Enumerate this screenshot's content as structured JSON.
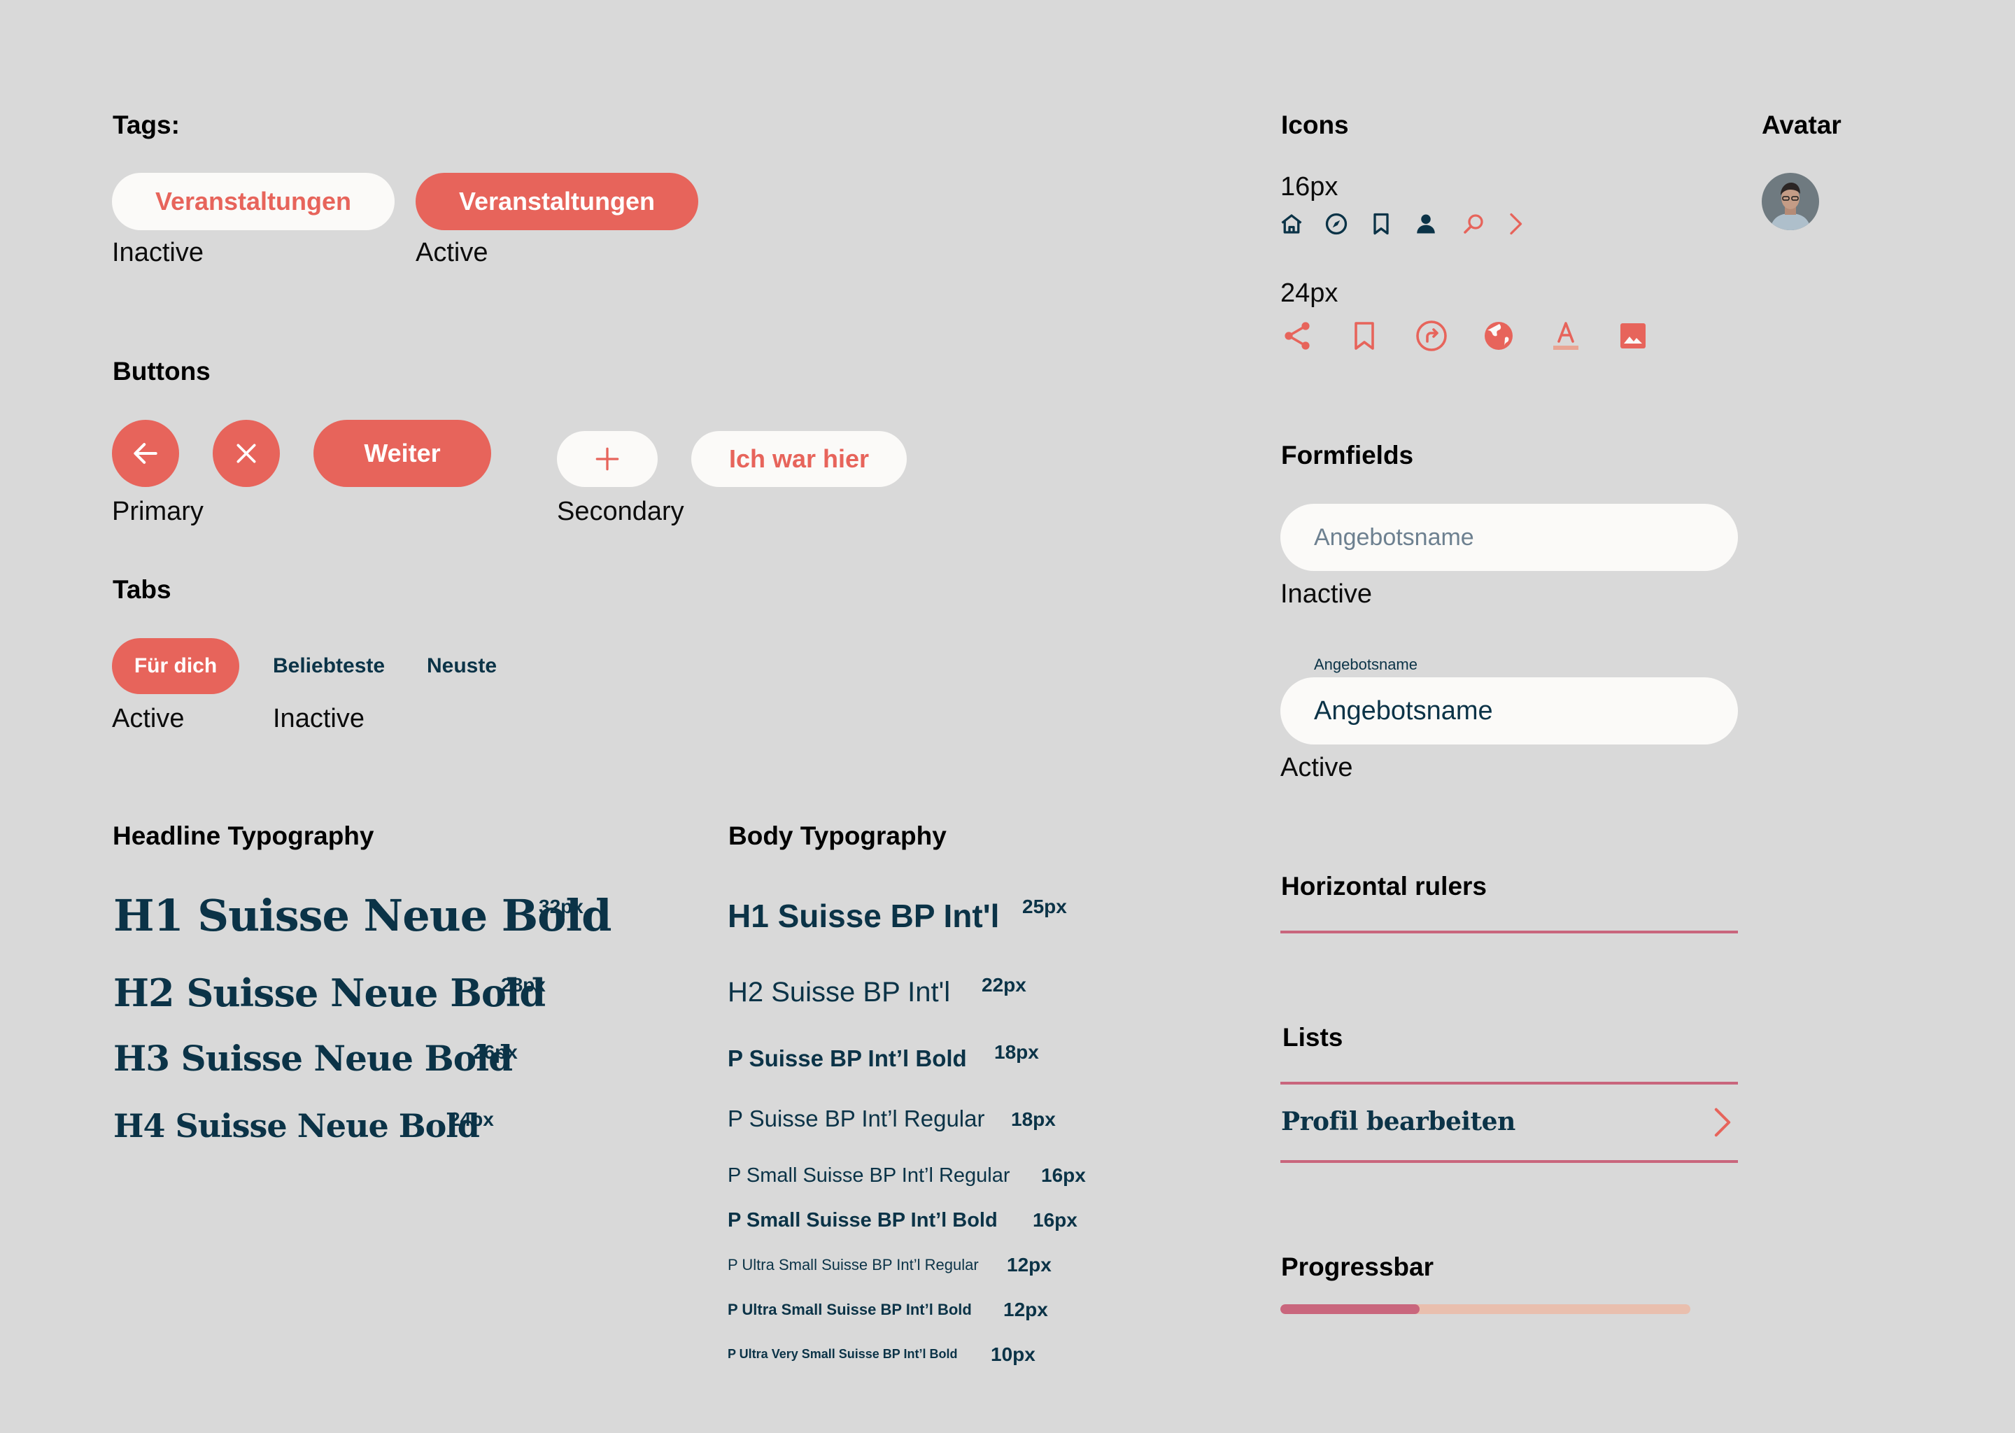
{
  "tags": {
    "title": "Tags:",
    "inactive_label": "Veranstaltungen",
    "inactive_caption": "Inactive",
    "active_label": "Veranstaltungen",
    "active_caption": "Active"
  },
  "buttons": {
    "title": "Buttons",
    "primary_back_icon": "arrow-left-icon",
    "primary_close_icon": "close-icon",
    "primary_label": "Weiter",
    "primary_caption": "Primary",
    "secondary_add_icon": "plus-icon",
    "secondary_label": "Ich war hier",
    "secondary_caption": "Secondary"
  },
  "tabs": {
    "title": "Tabs",
    "items": [
      "Für dich",
      "Beliebteste",
      "Neuste"
    ],
    "active_caption": "Active",
    "inactive_caption": "Inactive"
  },
  "headline_typography": {
    "title": "Headline Typography",
    "items": [
      {
        "text": "H1 Suisse Neue Bold",
        "size": "32px"
      },
      {
        "text": "H2 Suisse Neue Bold",
        "size": "28px"
      },
      {
        "text": "H3 Suisse Neue Bold",
        "size": "26px"
      },
      {
        "text": "H4 Suisse Neue Bold",
        "size": "24px"
      }
    ]
  },
  "body_typography": {
    "title": "Body Typography",
    "items": [
      {
        "text": "H1 Suisse BP Int'l",
        "size": "25px"
      },
      {
        "text": "H2 Suisse BP Int'l",
        "size": "22px"
      },
      {
        "text": "P Suisse BP Int’l Bold",
        "size": "18px"
      },
      {
        "text": "P Suisse BP Int’l Regular",
        "size": "18px"
      },
      {
        "text": "P Small Suisse BP Int’l Regular",
        "size": "16px"
      },
      {
        "text": "P Small Suisse BP Int’l Bold",
        "size": "16px"
      },
      {
        "text": "P Ultra Small Suisse BP Int’l Regular",
        "size": "12px"
      },
      {
        "text": "P Ultra Small Suisse BP Int’l Bold",
        "size": "12px"
      },
      {
        "text": "P Ultra Very Small Suisse BP Int’l Bold",
        "size": "10px"
      }
    ]
  },
  "icons": {
    "title": "Icons",
    "small_label": "16px",
    "small_icons": [
      "home-icon",
      "compass-icon",
      "bookmark-icon",
      "user-icon",
      "search-icon",
      "chevron-right-icon"
    ],
    "large_label": "24px",
    "large_icons": [
      "share-icon",
      "bookmark-icon",
      "redirect-icon",
      "globe-icon",
      "text-color-icon",
      "image-icon"
    ]
  },
  "avatar": {
    "title": "Avatar"
  },
  "formfields": {
    "title": "Formfields",
    "inactive_placeholder": "Angebotsname",
    "inactive_caption": "Inactive",
    "active_floating_label": "Angebotsname",
    "active_value": "Angebotsname",
    "active_caption": "Active"
  },
  "rulers": {
    "title": "Horizontal rulers"
  },
  "lists": {
    "title": "Lists",
    "item_label": "Profil bearbeiten"
  },
  "progressbar": {
    "title": "Progressbar",
    "progress": 0.34
  },
  "colors": {
    "accent": "#e7645b",
    "navy": "#0b3347",
    "background": "#d9d9d9",
    "surface": "#fbfaf8",
    "rule": "#c9667d",
    "progress_track": "#e9bfae"
  }
}
